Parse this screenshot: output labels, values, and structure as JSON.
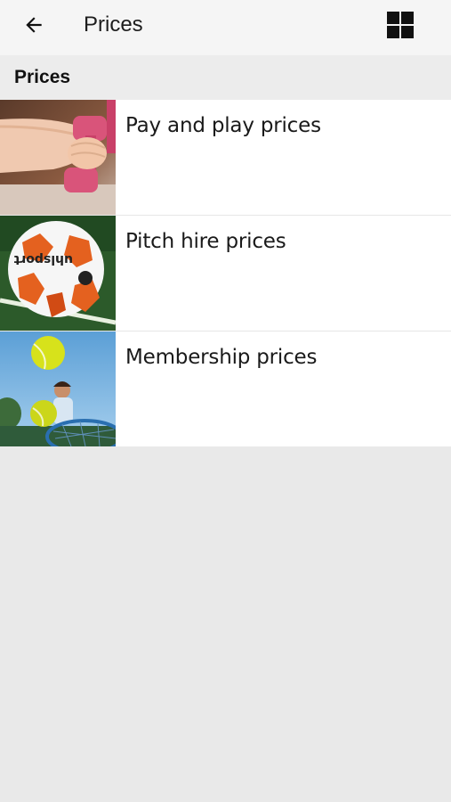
{
  "appbar": {
    "title": "Prices",
    "back_icon": "arrow-left-icon",
    "grid_icon": "grid-view-icon"
  },
  "section": {
    "title": "Prices"
  },
  "items": [
    {
      "label": "Pay and play prices",
      "image": "dumbbells-photo"
    },
    {
      "label": "Pitch hire prices",
      "image": "football-photo"
    },
    {
      "label": "Membership prices",
      "image": "tennis-photo"
    }
  ],
  "colors": {
    "appbar_bg": "#f5f5f5",
    "page_bg": "#e9e9e9",
    "list_bg": "#ffffff",
    "text": "#1a1a1a"
  }
}
